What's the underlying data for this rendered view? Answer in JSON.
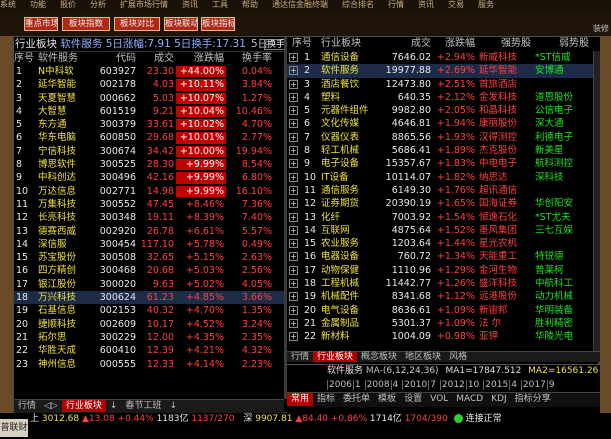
{
  "topbar": {
    "items": [
      "系统",
      "功能",
      "报价",
      "分析",
      "扩展市场行情",
      "资讯",
      "工具",
      "帮助",
      "通达信金融终端",
      "综合排名",
      "行情",
      "资讯",
      "交易",
      "服务"
    ]
  },
  "toolbar": {
    "buttons": [
      "重点市场",
      "板块指数",
      "板块对比",
      "板块联动",
      "板块指标"
    ],
    "right_label": "装修"
  },
  "left": {
    "header_prefix": "行业板块",
    "header_name": "软件服务",
    "header_stats": "5日涨幅:7.91 5日换手:17.31",
    "header_right": "5日",
    "header_btn": "换手",
    "columns": [
      "序号",
      "软件服务",
      "代码",
      "成交",
      "涨跌幅",
      "换手率"
    ],
    "rows": [
      [
        "1",
        "N中科软",
        "603927",
        "23.30",
        "+44.00%",
        "0.04%"
      ],
      [
        "2",
        "延华智能",
        "002178",
        "4.03",
        "+10.11%",
        "3.84%"
      ],
      [
        "3",
        "天夏智慧",
        "000662",
        "5.03",
        "+10.07%",
        "1.27%"
      ],
      [
        "4",
        "大智慧",
        "601519",
        "9.21",
        "+10.04%",
        "10.46%"
      ],
      [
        "5",
        "东方通",
        "300379",
        "33.61",
        "+10.02%",
        "4.70%"
      ],
      [
        "6",
        "华东电脑",
        "600850",
        "29.68",
        "+10.01%",
        "2.77%"
      ],
      [
        "7",
        "宁信科技",
        "300674",
        "34.42",
        "+10.00%",
        "19.94%"
      ],
      [
        "8",
        "博思软件",
        "300525",
        "28.30",
        "+9.99%",
        "8.54%"
      ],
      [
        "9",
        "中科创达",
        "300496",
        "42.16",
        "+9.99%",
        "6.80%"
      ],
      [
        "10",
        "万达信息",
        "002771",
        "14.98",
        "+9.99%",
        "16.10%"
      ],
      [
        "11",
        "万集科技",
        "300552",
        "47.45",
        "+8.46%",
        "7.36%"
      ],
      [
        "12",
        "长亮科技",
        "300348",
        "19.11",
        "+8.39%",
        "7.40%"
      ],
      [
        "13",
        "德赛西威",
        "002920",
        "26.78",
        "+6.61%",
        "5.57%"
      ],
      [
        "14",
        "深信服",
        "300454",
        "117.10",
        "+5.78%",
        "0.49%"
      ],
      [
        "15",
        "苏宝股份",
        "300508",
        "32.65",
        "+5.15%",
        "2.63%"
      ],
      [
        "16",
        "四方精创",
        "300468",
        "20.68",
        "+5.03%",
        "2.56%"
      ],
      [
        "17",
        "银江股份",
        "300020",
        "9.63",
        "+5.02%",
        "4.05%"
      ],
      [
        "18",
        "万兴科技",
        "300624",
        "61.23",
        "+4.85%",
        "3.66%"
      ],
      [
        "19",
        "石基信息",
        "002153",
        "40.32",
        "+4.70%",
        "1.35%"
      ],
      [
        "20",
        "捷顺科技",
        "002609",
        "10.17",
        "+4.52%",
        "3.24%"
      ],
      [
        "21",
        "拓尔思",
        "300229",
        "12.00",
        "+4.35%",
        "2.35%"
      ],
      [
        "22",
        "华胜天成",
        "600410",
        "12.39",
        "+4.21%",
        "4.32%"
      ],
      [
        "23",
        "神州信息",
        "000555",
        "12.33",
        "+4.14%",
        "2.23%"
      ]
    ],
    "tabs": [
      "行情",
      "◁▷",
      "行业板块",
      "↓",
      "春节工班",
      "↓"
    ]
  },
  "right": {
    "columns": [
      "序号",
      "行业板块",
      "成交",
      "涨跌幅",
      "强势股",
      "弱势股"
    ],
    "rows": [
      [
        "1",
        "通信设备",
        "7646.02",
        "+2.94%",
        "新威科技",
        "*ST信威"
      ],
      [
        "2",
        "软件服务",
        "19977.88",
        "+2.69%",
        "延华智能",
        "安博通"
      ],
      [
        "3",
        "酒店餐饮",
        "12473.80",
        "+2.51%",
        "首旅酒店",
        ""
      ],
      [
        "4",
        "塑料",
        "640.35",
        "+2.12%",
        "金发科技",
        "道恩股份"
      ],
      [
        "5",
        "元器件组件",
        "9982.80",
        "+2.05%",
        "和晶科技",
        "公信电子"
      ],
      [
        "6",
        "文化传媒",
        "4646.81",
        "+1.94%",
        "康丽股份",
        "深大通"
      ],
      [
        "7",
        "仪器仪表",
        "8865.56",
        "+1.93%",
        "汉得测控",
        "利德电子"
      ],
      [
        "8",
        "轻工机械",
        "5686.41",
        "+1.89%",
        "杰克股份",
        "新美星"
      ],
      [
        "9",
        "电子设备",
        "15357.67",
        "+1.83%",
        "中电电子",
        "航科测控"
      ],
      [
        "10",
        "IT设备",
        "10114.07",
        "+1.82%",
        "纳思达",
        "深科技"
      ],
      [
        "11",
        "通信服务",
        "6149.30",
        "+1.76%",
        "超讯通信",
        ""
      ],
      [
        "12",
        "证券期货",
        "20390.19",
        "+1.65%",
        "国海证券",
        "华创阳安"
      ],
      [
        "13",
        "化纤",
        "7003.92",
        "+1.54%",
        "恒逸石化",
        "*ST尤夫"
      ],
      [
        "14",
        "互联网",
        "4875.64",
        "+1.52%",
        "墨风集团",
        "三七互娱"
      ],
      [
        "15",
        "农业服务",
        "1203.64",
        "+1.44%",
        "星光农机",
        ""
      ],
      [
        "16",
        "电器设备",
        "760.72",
        "+1.34%",
        "天能重工",
        "特锐德"
      ],
      [
        "17",
        "动物保健",
        "1110.96",
        "+1.29%",
        "金河生物",
        "普莱柯"
      ],
      [
        "18",
        "工程机械",
        "11442.77",
        "+1.26%",
        "盛洋科技",
        "中航科工"
      ],
      [
        "19",
        "机械配件",
        "8341.68",
        "+1.12%",
        "远港股份",
        "动力机械"
      ],
      [
        "20",
        "电气设备",
        "8636.61",
        "+1.09%",
        "新宙邦",
        "华明装备"
      ],
      [
        "21",
        "金属制品",
        "5301.37",
        "+1.09%",
        "法  尔",
        "胜利精密"
      ],
      [
        "22",
        "新材料",
        "1004.09",
        "+0.98%",
        "亚钾",
        "华陵光电"
      ]
    ],
    "tabs": [
      "行情",
      "行业板块",
      "概念板块",
      "地区板块",
      "风格"
    ],
    "kline": {
      "name": "软件服务",
      "ma_label": "MA-",
      "ma_params": "(6,12,24,36)",
      "ma1": "MA1=17847.512",
      "ma2": "MA2=16561.26",
      "years": [
        "2006",
        "1",
        "2008",
        "4",
        "2010",
        "7",
        "2012",
        "10",
        "2015",
        "4",
        "2017",
        "9"
      ],
      "menu": [
        "常用",
        "指标",
        "委托单",
        "模板",
        "设置",
        "VOL",
        "MACD",
        "KDJ",
        "指标分享"
      ]
    }
  },
  "status": {
    "sh_label": "上",
    "sh_val": "3012.68",
    "sh_chg": "▲13.08",
    "sh_pct": "+0.44%",
    "sh_amt": "1183亿",
    "sh_cnt": "1137/270",
    "sz_label": "深",
    "sz_val": "9907.81",
    "sz_chg": "▲84.40",
    "sz_pct": "+0.86%",
    "sz_amt": "1714亿",
    "sz_cnt": "1704/390",
    "conn": "连接正常",
    "left_label": "普联财"
  }
}
